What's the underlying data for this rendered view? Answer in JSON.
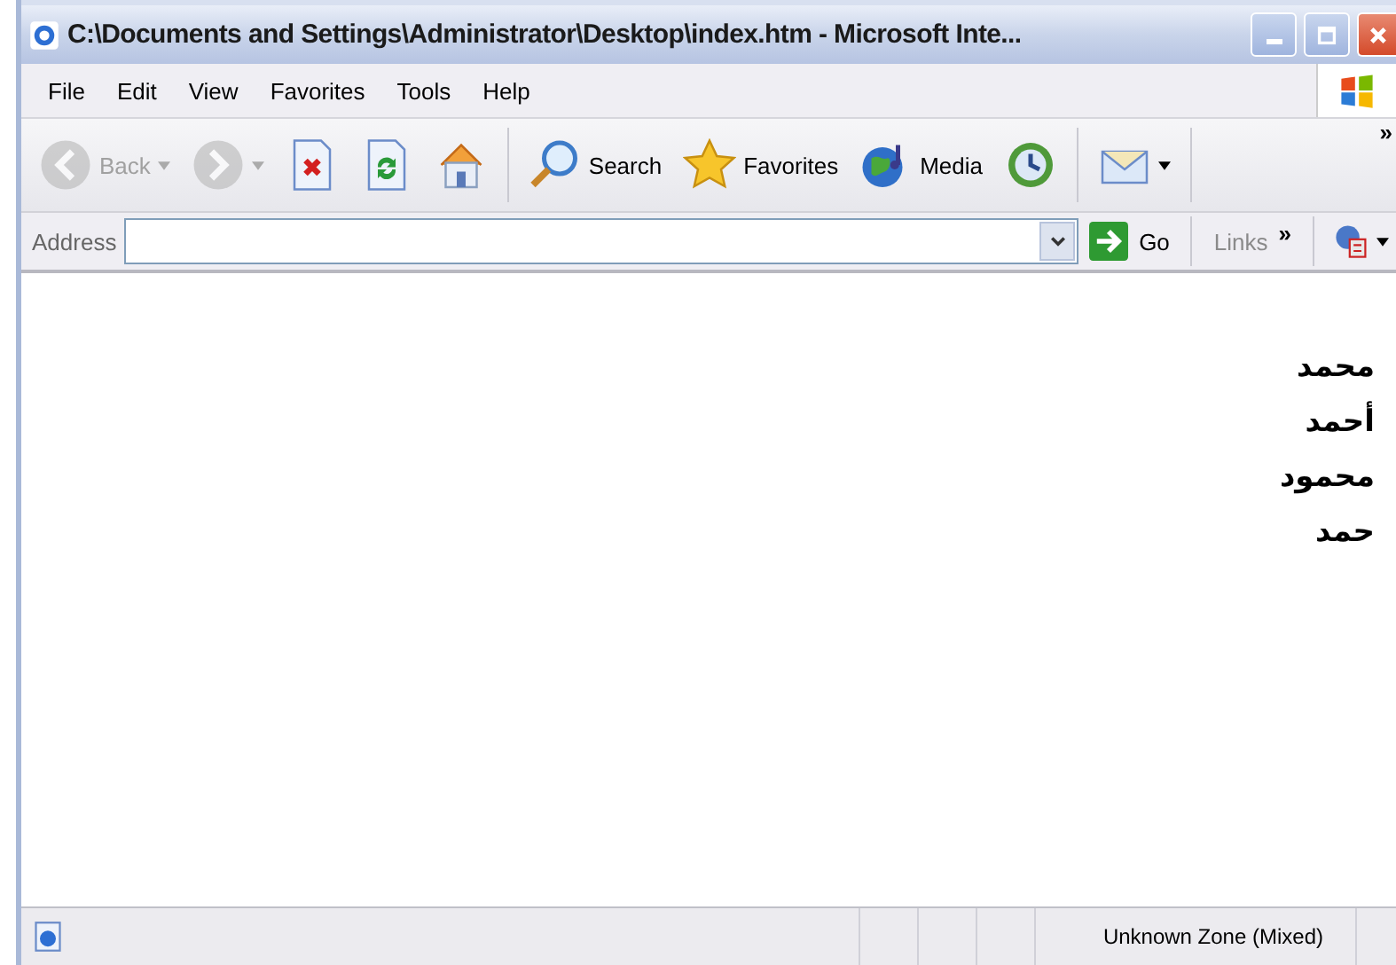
{
  "window": {
    "title": "C:\\Documents and Settings\\Administrator\\Desktop\\index.htm - Microsoft Inte..."
  },
  "menu": [
    "File",
    "Edit",
    "View",
    "Favorites",
    "Tools",
    "Help"
  ],
  "toolbar": {
    "groups": [
      [
        {
          "kind": "back",
          "label": "Back",
          "disabled": true,
          "dropdown": true
        },
        {
          "kind": "forward",
          "disabled": true,
          "dropdown": true
        },
        {
          "kind": "stop",
          "disabled": false,
          "dropdown": false
        },
        {
          "kind": "refresh",
          "disabled": false,
          "dropdown": false
        },
        {
          "kind": "home",
          "disabled": false,
          "dropdown": false
        }
      ],
      [
        {
          "kind": "search",
          "label": "Search",
          "disabled": false,
          "dropdown": false
        },
        {
          "kind": "favorites",
          "label": "Favorites",
          "disabled": false,
          "dropdown": false
        },
        {
          "kind": "media",
          "label": "Media",
          "disabled": false,
          "dropdown": false
        },
        {
          "kind": "history",
          "disabled": false,
          "dropdown": false
        }
      ],
      [
        {
          "kind": "mail",
          "disabled": false,
          "dropdown": true
        }
      ]
    ],
    "overflow": "»"
  },
  "address_bar": {
    "label": "Address",
    "go": "Go",
    "links": "Links",
    "links_overflow": "»"
  },
  "content": {
    "lines": [
      "محمد",
      "أحمد",
      "محمود",
      "حمد"
    ]
  },
  "status_bar": {
    "zone": "Unknown Zone (Mixed)"
  }
}
